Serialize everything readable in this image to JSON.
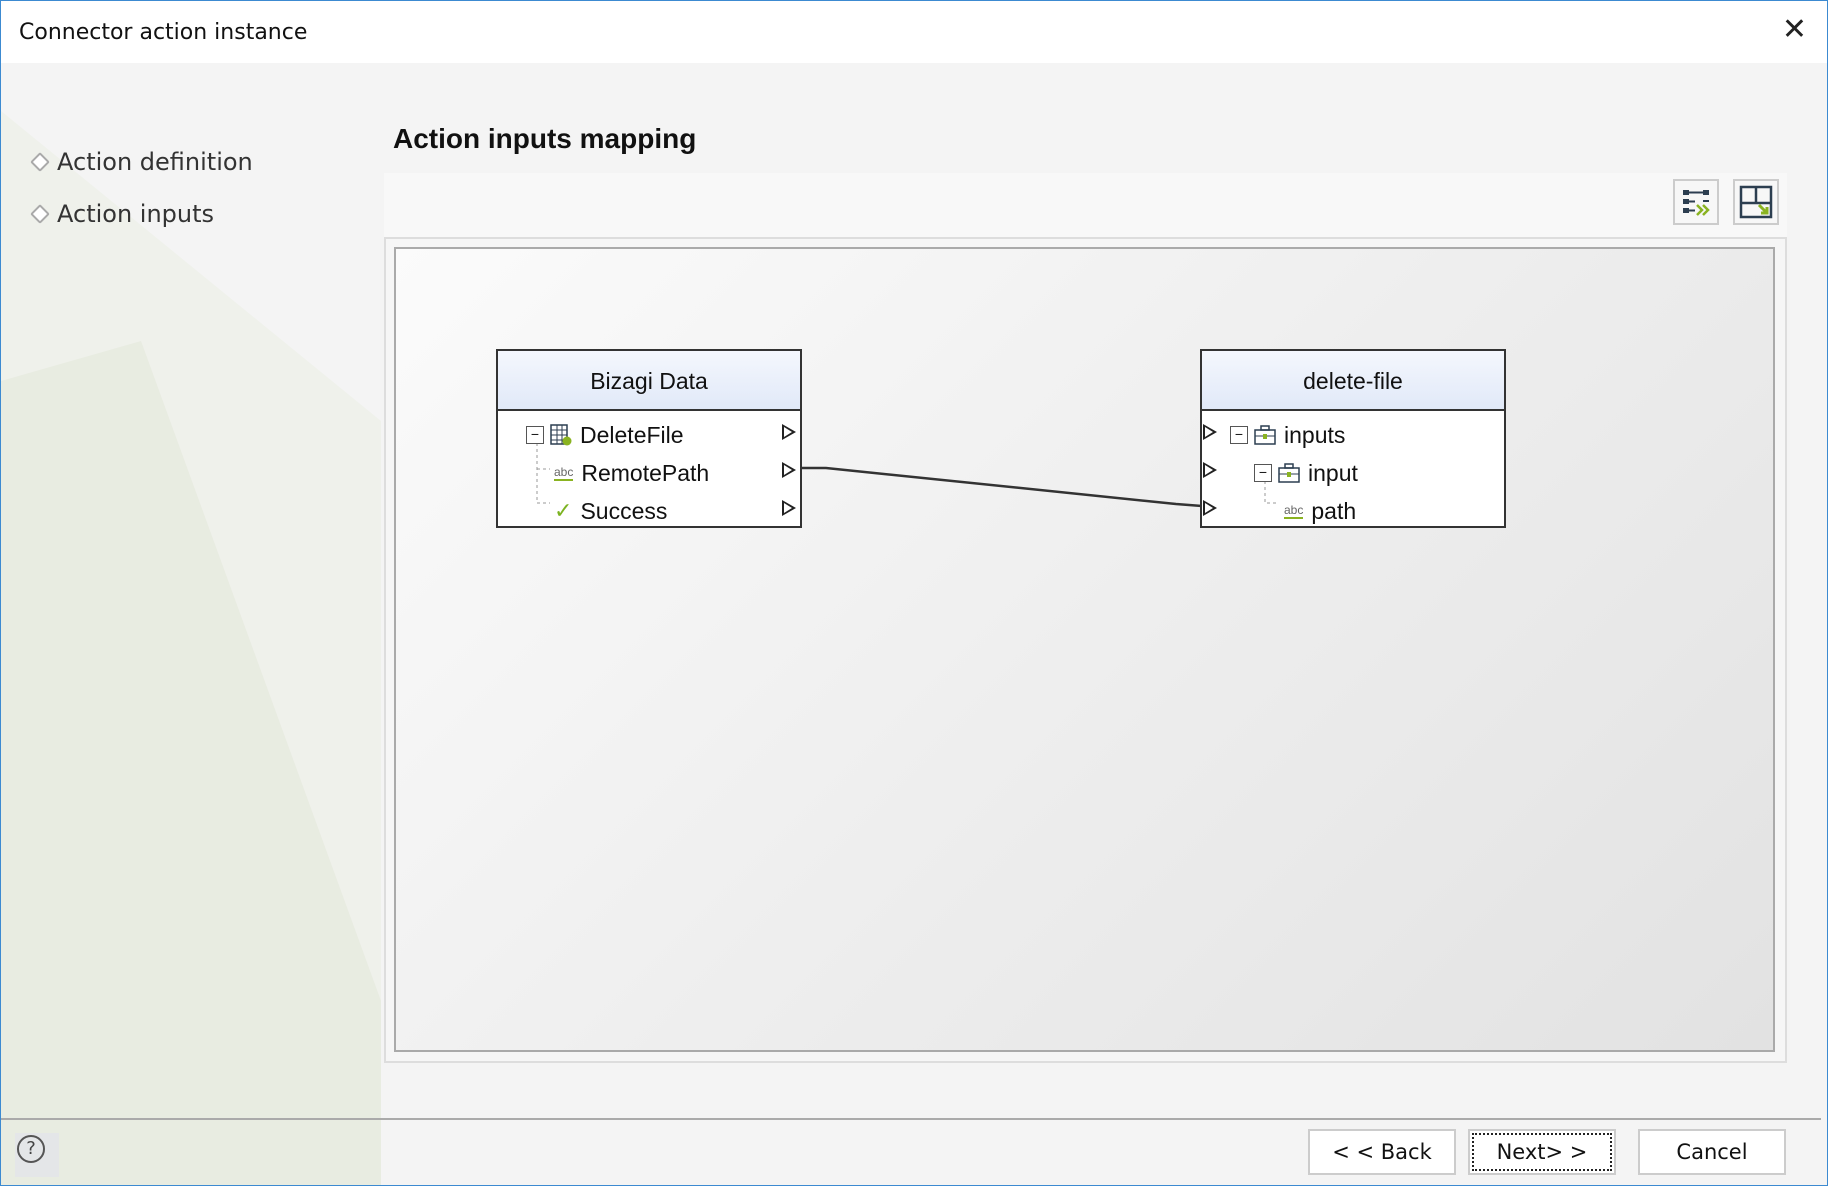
{
  "window": {
    "title": "Connector action instance",
    "close_icon": "close-icon"
  },
  "nav": {
    "items": [
      {
        "label": "Action definition"
      },
      {
        "label": "Action inputs"
      }
    ]
  },
  "main": {
    "heading": "Action inputs mapping",
    "toolbar": [
      {
        "icon": "auto-map-icon"
      },
      {
        "icon": "fit-view-icon"
      }
    ]
  },
  "mapping": {
    "source": {
      "title": "Bizagi Data",
      "items": [
        {
          "label": "DeleteFile",
          "icon": "entity-table-icon"
        },
        {
          "label": "RemotePath",
          "icon": "string-abc-icon"
        },
        {
          "label": "Success",
          "icon": "boolean-check-icon"
        }
      ]
    },
    "target": {
      "title": "delete-file",
      "items": [
        {
          "label": "inputs",
          "icon": "object-icon"
        },
        {
          "label": "input",
          "icon": "object-icon"
        },
        {
          "label": "path",
          "icon": "string-abc-icon"
        }
      ]
    },
    "connections": [
      {
        "from": "RemotePath",
        "to": "path"
      }
    ],
    "abc_text": "abc"
  },
  "footer": {
    "help": "?",
    "back": "< < Back",
    "next": "Next> >",
    "cancel": "Cancel"
  }
}
